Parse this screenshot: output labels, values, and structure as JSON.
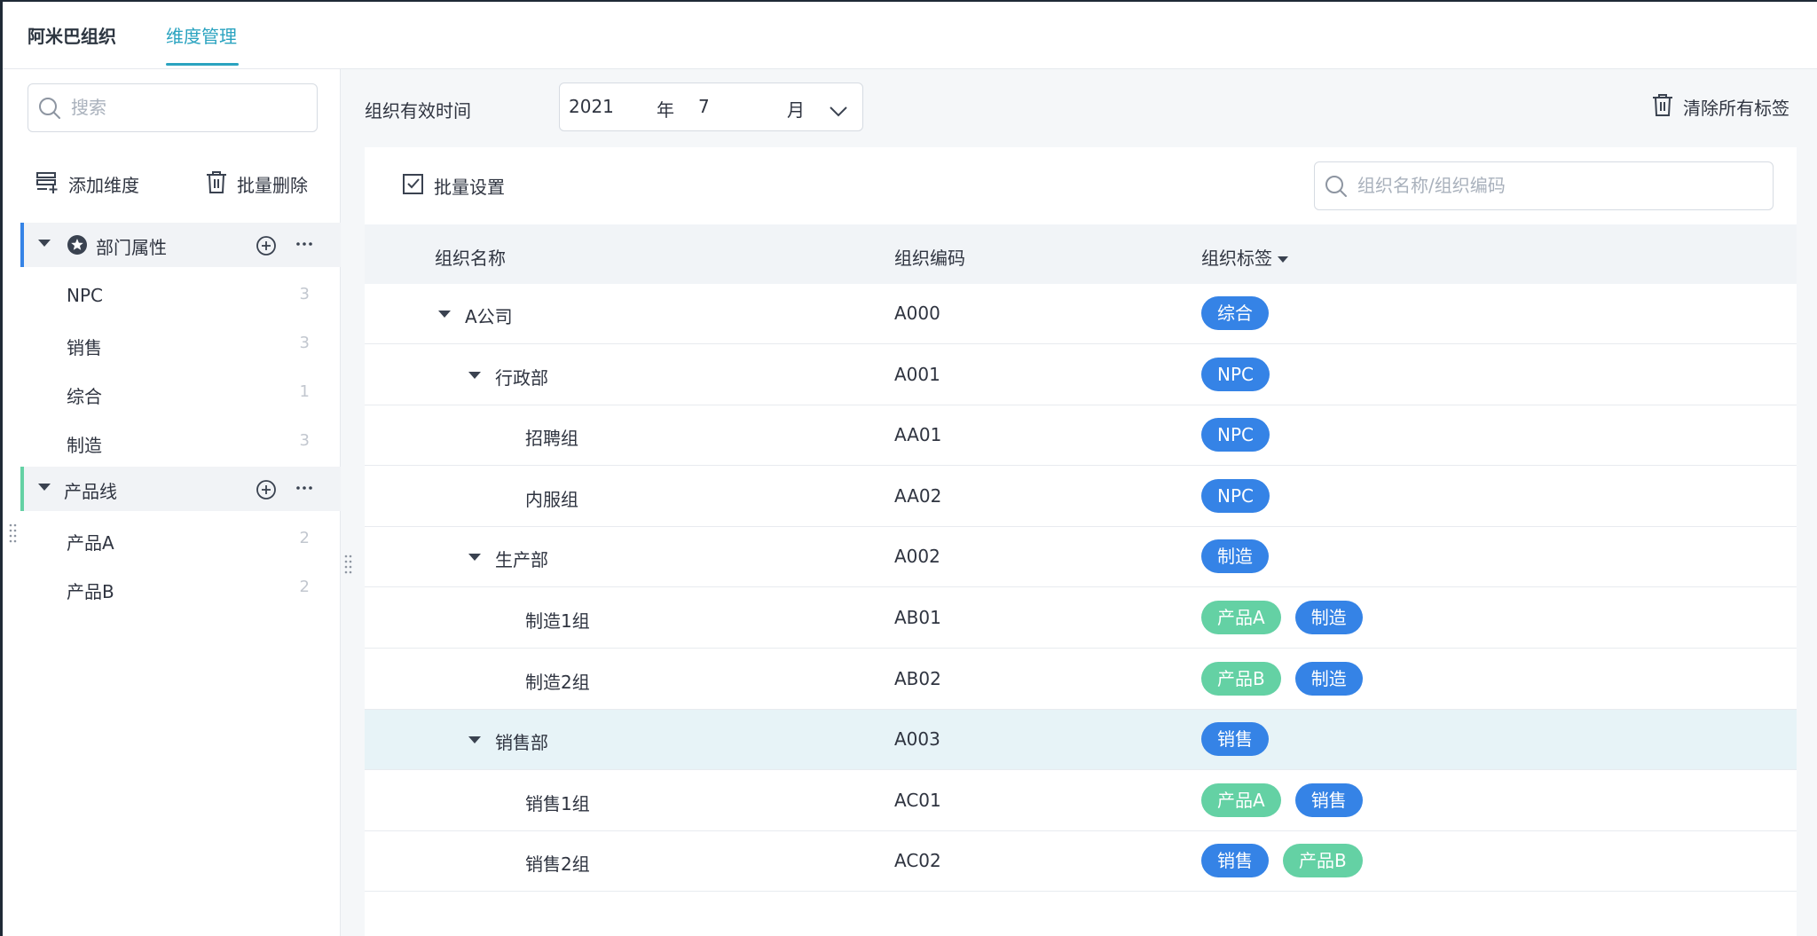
{
  "header": {
    "tabs": [
      {
        "label": "阿米巴组织"
      },
      {
        "label": "维度管理"
      }
    ]
  },
  "sidebar": {
    "search_placeholder": "搜索",
    "add_dimension": "添加维度",
    "batch_delete": "批量删除",
    "groups": [
      {
        "label": "部门属性",
        "accent": "#3583e6",
        "items": [
          {
            "label": "NPC",
            "count": "3"
          },
          {
            "label": "销售",
            "count": "3"
          },
          {
            "label": "综合",
            "count": "1"
          },
          {
            "label": "制造",
            "count": "3"
          }
        ]
      },
      {
        "label": "产品线",
        "accent": "#64d1a4",
        "items": [
          {
            "label": "产品A",
            "count": "2"
          },
          {
            "label": "产品B",
            "count": "2"
          }
        ]
      }
    ]
  },
  "filter": {
    "label": "组织有效时间",
    "year": "2021",
    "year_unit": "年",
    "month": "7",
    "month_unit": "月",
    "clear_all": "清除所有标签"
  },
  "table": {
    "batch_settings": "批量设置",
    "search_placeholder": "组织名称/组织编码",
    "columns": [
      "组织名称",
      "组织编码",
      "组织标签"
    ],
    "rows": [
      {
        "name": "A公司",
        "code": "A000",
        "tags": [
          {
            "text": "综合",
            "color": "blue"
          }
        ]
      },
      {
        "name": "行政部",
        "code": "A001",
        "tags": [
          {
            "text": "NPC",
            "color": "blue"
          }
        ]
      },
      {
        "name": "招聘组",
        "code": "AA01",
        "tags": [
          {
            "text": "NPC",
            "color": "blue"
          }
        ]
      },
      {
        "name": "内服组",
        "code": "AA02",
        "tags": [
          {
            "text": "NPC",
            "color": "blue"
          }
        ]
      },
      {
        "name": "生产部",
        "code": "A002",
        "tags": [
          {
            "text": "制造",
            "color": "blue"
          }
        ]
      },
      {
        "name": "制造1组",
        "code": "AB01",
        "tags": [
          {
            "text": "产品A",
            "color": "green"
          },
          {
            "text": "制造",
            "color": "blue"
          }
        ]
      },
      {
        "name": "制造2组",
        "code": "AB02",
        "tags": [
          {
            "text": "产品B",
            "color": "green"
          },
          {
            "text": "制造",
            "color": "blue"
          }
        ]
      },
      {
        "name": "销售部",
        "code": "A003",
        "tags": [
          {
            "text": "销售",
            "color": "blue"
          }
        ]
      },
      {
        "name": "销售1组",
        "code": "AC01",
        "tags": [
          {
            "text": "产品A",
            "color": "green"
          },
          {
            "text": "销售",
            "color": "blue"
          }
        ]
      },
      {
        "name": "销售2组",
        "code": "AC02",
        "tags": [
          {
            "text": "销售",
            "color": "blue"
          },
          {
            "text": "产品B",
            "color": "green"
          }
        ]
      }
    ]
  },
  "colors": {
    "accent_teal": "#2aa3c0",
    "tag_blue": "#3583e6",
    "tag_green": "#64d1a4",
    "selected_row": "#e7f3f7"
  }
}
